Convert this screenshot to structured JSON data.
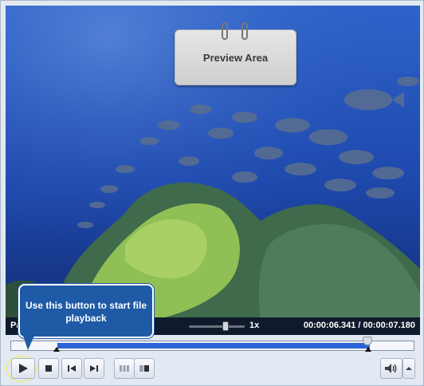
{
  "preview": {
    "label": "Preview Area"
  },
  "status": {
    "left_text": "Pa",
    "speed": "1x",
    "current_time": "00:00:06.341",
    "separator": "/",
    "total_time": "00:00:07.180"
  },
  "tooltip": {
    "text": "Use this button to start file playback"
  },
  "timeline": {
    "progress_fraction": 0.883
  },
  "controls": {
    "play_icon": "play-icon",
    "stop_icon": "stop-icon",
    "prev_icon": "skip-back-icon",
    "next_icon": "skip-forward-icon",
    "volume_icon": "speaker-icon"
  },
  "colors": {
    "tooltip_bg": "#1f5aa6",
    "timeline_fill": "#2c64d8",
    "highlight": "#f2ef3a"
  }
}
